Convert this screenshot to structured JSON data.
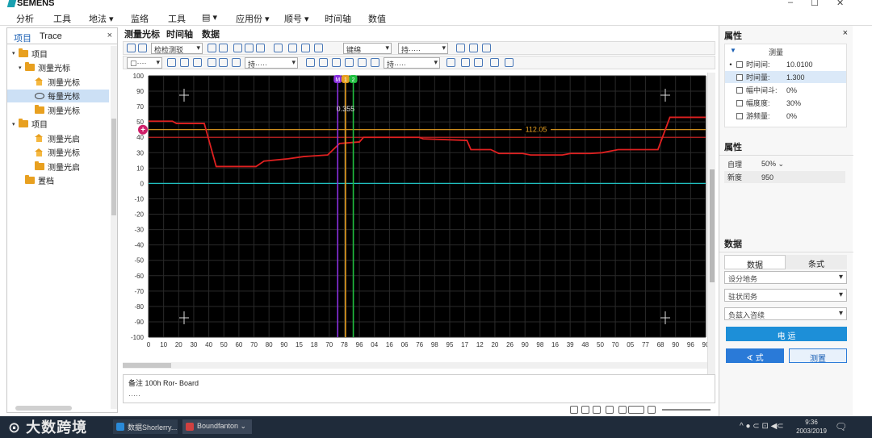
{
  "app": {
    "logo_text": "SEMENS",
    "controls": {
      "minimize": "–",
      "maximize": "☐",
      "close": "✕"
    }
  },
  "menu": [
    "分析",
    "工具",
    "地法 ▾",
    "监络",
    "工具",
    "▤ ▾",
    "应用份 ▾",
    "顺号 ▾",
    "时间轴",
    "数值"
  ],
  "left_panel": {
    "tabs": [
      "项目",
      "Trace"
    ],
    "close": "×",
    "tree": [
      {
        "label": "项目",
        "level": 0,
        "icon": "folder",
        "expander": "▾"
      },
      {
        "label": "测量光标",
        "level": 1,
        "icon": "folder",
        "expander": "▾"
      },
      {
        "label": "测量光标",
        "level": 2,
        "icon": "house",
        "expander": ""
      },
      {
        "label": "每量光标",
        "level": 2,
        "icon": "eye",
        "expander": "",
        "selected": true
      },
      {
        "label": "测量光标",
        "level": 2,
        "icon": "folder",
        "expander": ""
      },
      {
        "label": "项目",
        "level": 0,
        "icon": "folder",
        "expander": "▾"
      },
      {
        "label": "测量光启",
        "level": 2,
        "icon": "house",
        "expander": ""
      },
      {
        "label": "测量光标",
        "level": 2,
        "icon": "house",
        "expander": ""
      },
      {
        "label": "测量光启",
        "level": 2,
        "icon": "folder",
        "expander": ""
      },
      {
        "label": "置档",
        "level": 1,
        "icon": "folder",
        "expander": ""
      }
    ]
  },
  "center": {
    "tabs": [
      "测量光标",
      "时间轴",
      "数据"
    ],
    "toolbar1": {
      "combo1": "检检测驳",
      "combo2": "键绵",
      "combo3": "持·····"
    },
    "toolbar2": {
      "combo1": "▢····",
      "combo2": "持·····",
      "combo3": "持·····"
    },
    "notes": {
      "label": "备注  100h Ror- Board",
      "sub": "·····"
    }
  },
  "chart_data": {
    "type": "line",
    "xlim": [
      0,
      90
    ],
    "ylim": [
      -100,
      100
    ],
    "x_ticks": [
      0,
      10,
      20,
      30,
      40,
      50,
      60,
      70,
      80,
      90
    ],
    "x_tick_labels": [
      "0",
      "10",
      "20",
      "30",
      "40",
      "50",
      "60",
      "70",
      "80",
      "90",
      "15",
      "18",
      "70",
      "78",
      "96",
      "04",
      "16",
      "06",
      "76",
      "98",
      "95",
      "17",
      "12",
      "20",
      "26",
      "90",
      "98",
      "16",
      "39",
      "48",
      "50",
      "70",
      "05",
      "77",
      "68",
      "90",
      "96",
      "90"
    ],
    "y_ticks": [
      100,
      90,
      70,
      50,
      40,
      30,
      10,
      0,
      -10,
      -20,
      -30,
      -40,
      -50,
      -60,
      -70,
      -80,
      -90,
      -100
    ],
    "y_tick_labels": [
      "100",
      "90",
      "70",
      "50",
      "40",
      "30",
      "10",
      "0",
      "-10",
      "-20",
      "-30",
      "-40",
      "-50",
      "-60",
      "-70",
      "-80",
      "-90",
      "-100"
    ],
    "grid": true,
    "series": [
      {
        "color": "#e02020",
        "points": [
          [
            0,
            51
          ],
          [
            6,
            51
          ],
          [
            7,
            49
          ],
          [
            14,
            49
          ],
          [
            17,
            12
          ],
          [
            27,
            12
          ],
          [
            29,
            19
          ],
          [
            35,
            22
          ],
          [
            39,
            25
          ],
          [
            45,
            27
          ],
          [
            48,
            36
          ],
          [
            53,
            37
          ],
          [
            54,
            40
          ],
          [
            68,
            40
          ],
          [
            69,
            39
          ],
          [
            80,
            38
          ],
          [
            81,
            32
          ],
          [
            86,
            32
          ],
          [
            88,
            29
          ],
          [
            94,
            29
          ],
          [
            96,
            27
          ],
          [
            104,
            27
          ],
          [
            106,
            29
          ],
          [
            111,
            29
          ],
          [
            114,
            30
          ],
          [
            118,
            32
          ],
          [
            128,
            32
          ],
          [
            131,
            56
          ],
          [
            140,
            56
          ]
        ]
      }
    ],
    "horizontal_lines": [
      {
        "y": 45,
        "color": "#e8a020",
        "label": "112.05"
      },
      {
        "y": 40,
        "color": "#c02020",
        "label": ""
      },
      {
        "y": 0,
        "color": "#20c0c0",
        "label": ""
      }
    ],
    "cursors": [
      {
        "x": 48.5,
        "color": "#8a30e0",
        "tag": "M"
      },
      {
        "x": 50.5,
        "color": "#e8a020",
        "tag": "1"
      },
      {
        "x": 52.5,
        "color": "#20c040",
        "tag": "2"
      }
    ],
    "cursor_readout": "0.355",
    "marker_left": "+"
  },
  "right_panel": {
    "section1": {
      "title": "属性",
      "close": "×",
      "header": "测量",
      "rows": [
        {
          "label": "时间间:",
          "value": "10.0100",
          "bullet": "•"
        },
        {
          "label": "时间量:",
          "value": "1.300",
          "highlight": true
        },
        {
          "label": "幅中间斗:",
          "value": "0%"
        },
        {
          "label": "幅度度:",
          "value": "30%"
        },
        {
          "label": "游频量:",
          "value": "0%"
        }
      ]
    },
    "section2": {
      "title": "属性",
      "rows": [
        {
          "label": "自理",
          "value": "50%  ⌄"
        },
        {
          "label": "新度",
          "value": "950"
        }
      ]
    },
    "section3": {
      "title": "数据",
      "tabs": [
        "数据",
        "条式"
      ],
      "selects": [
        "设分地务",
        "驻状闰务",
        "负兹入咨续"
      ],
      "primary_button": "电   运",
      "button_left": "∢ 式",
      "button_right": "测置"
    }
  },
  "taskbar": {
    "watermark": "⊙ 大数跨境",
    "apps": [
      {
        "label": "数据Shorlerry...",
        "color": "#2a8ad8"
      },
      {
        "label": "Boundfanton ⌄",
        "color": "#d04040"
      }
    ],
    "tray": "^  ● ⊂ ⊡ ◀⊂",
    "time": "9:36",
    "date": "2003/2019"
  }
}
